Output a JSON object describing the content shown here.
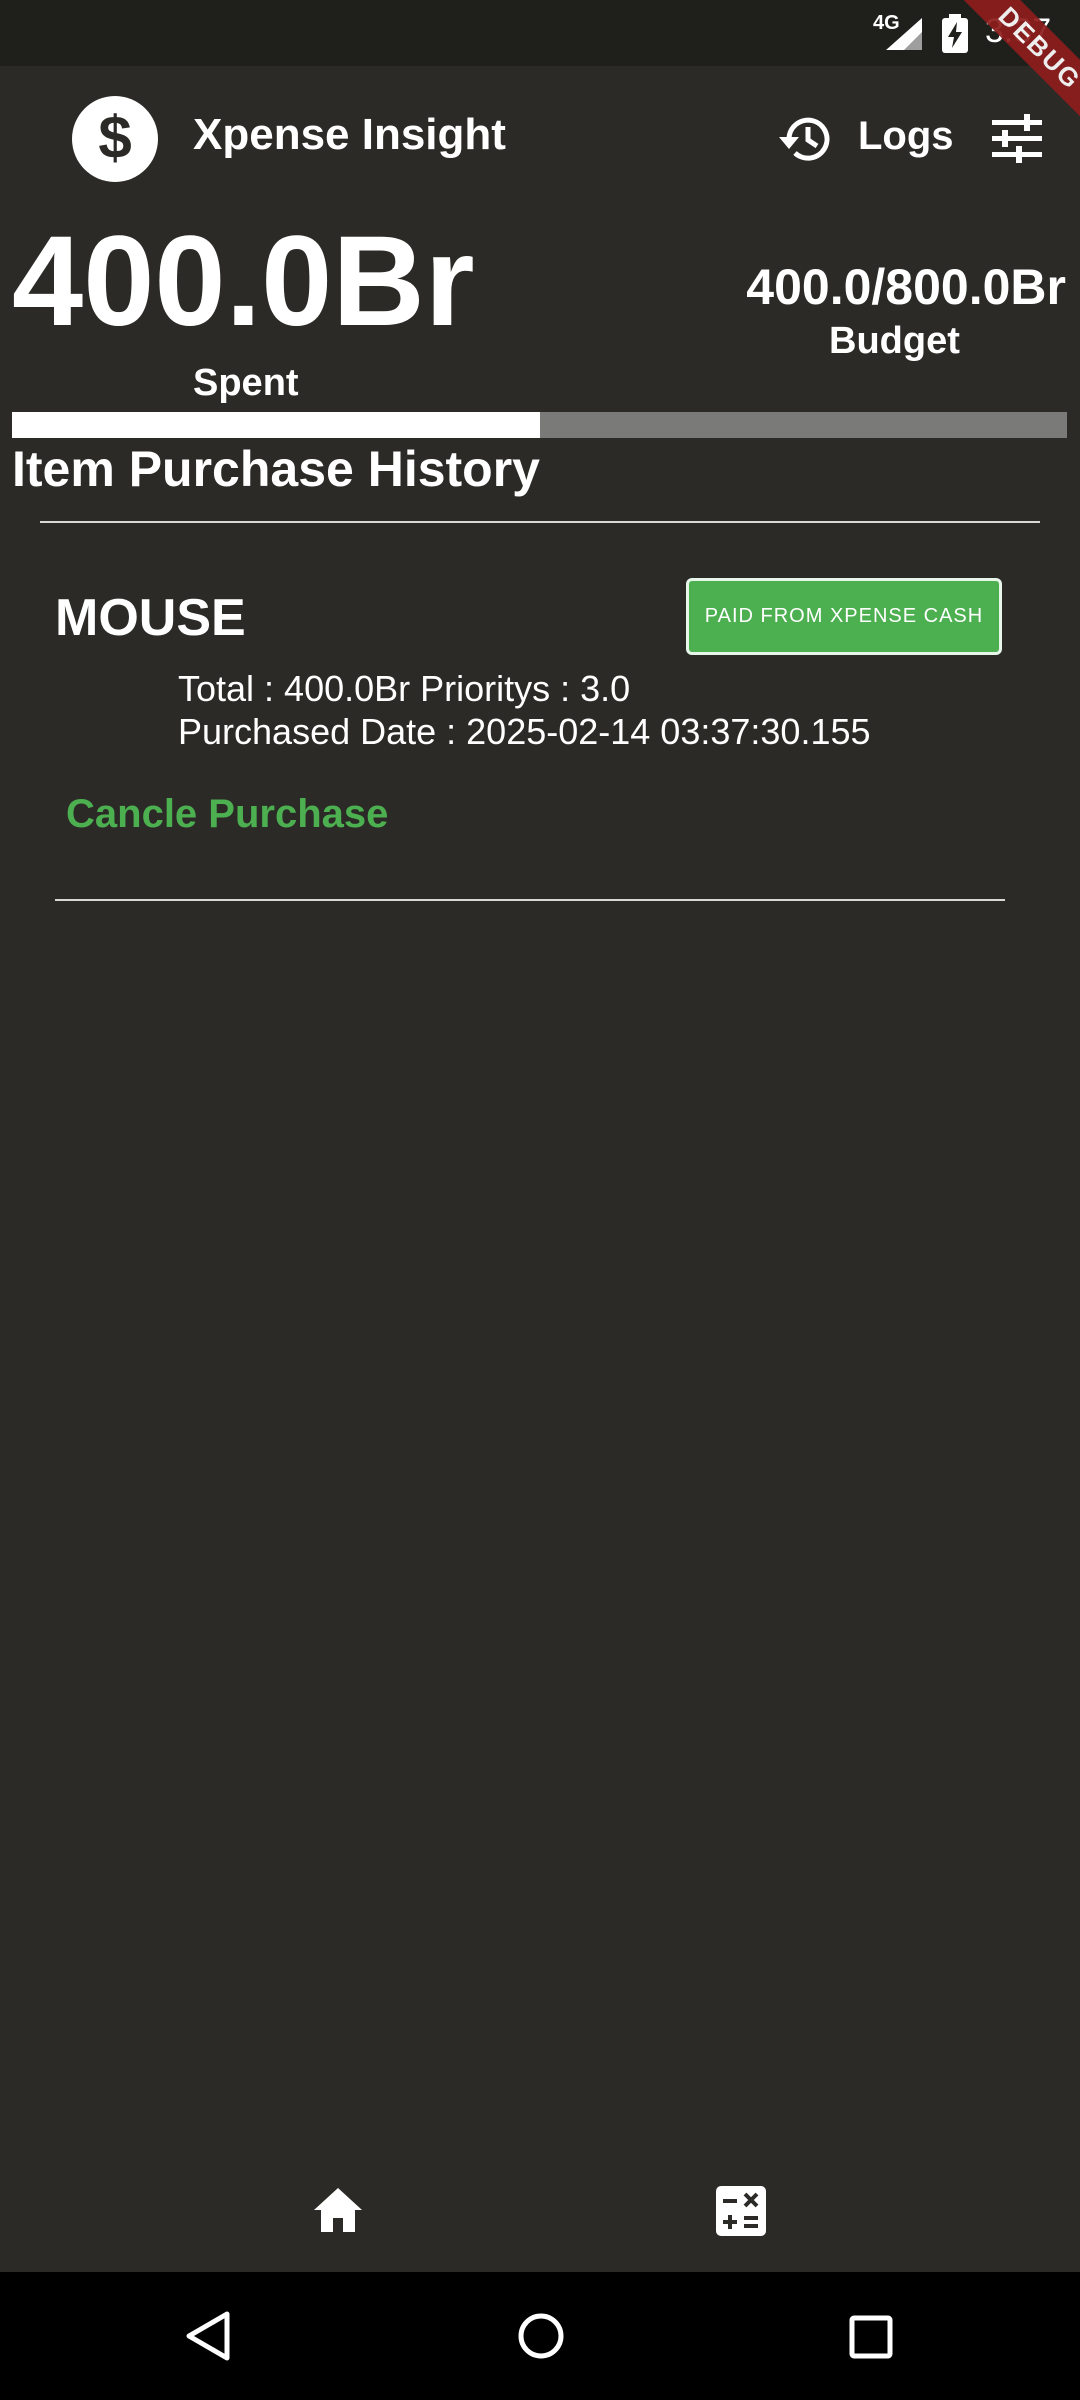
{
  "status_bar": {
    "network": "4G",
    "time": "3:37"
  },
  "debug_ribbon": "DEBUG",
  "app_bar": {
    "title": "Xpense Insight",
    "logs_label": "Logs"
  },
  "summary": {
    "spent_amount": "400.0Br",
    "spent_label": "Spent",
    "budget_amount": "400.0/800.0Br",
    "budget_label": "Budget",
    "progress_fraction": 0.5
  },
  "history": {
    "title": "Item Purchase History",
    "items": [
      {
        "name": "MOUSE",
        "payment_source": "PAID FROM  XPENSE CASH",
        "total_line": "Total : 400.0Br Prioritys : 3.0",
        "date_line": "Purchased Date : 2025-02-14 03:37:30.155",
        "cancel_label": "Cancle Purchase"
      }
    ]
  },
  "bottom_nav": {
    "items": [
      "home-icon",
      "calculator-icon"
    ]
  },
  "colors": {
    "background": "#2b2a26",
    "accent": "#4caf50",
    "ribbon": "#8e1d1d"
  }
}
